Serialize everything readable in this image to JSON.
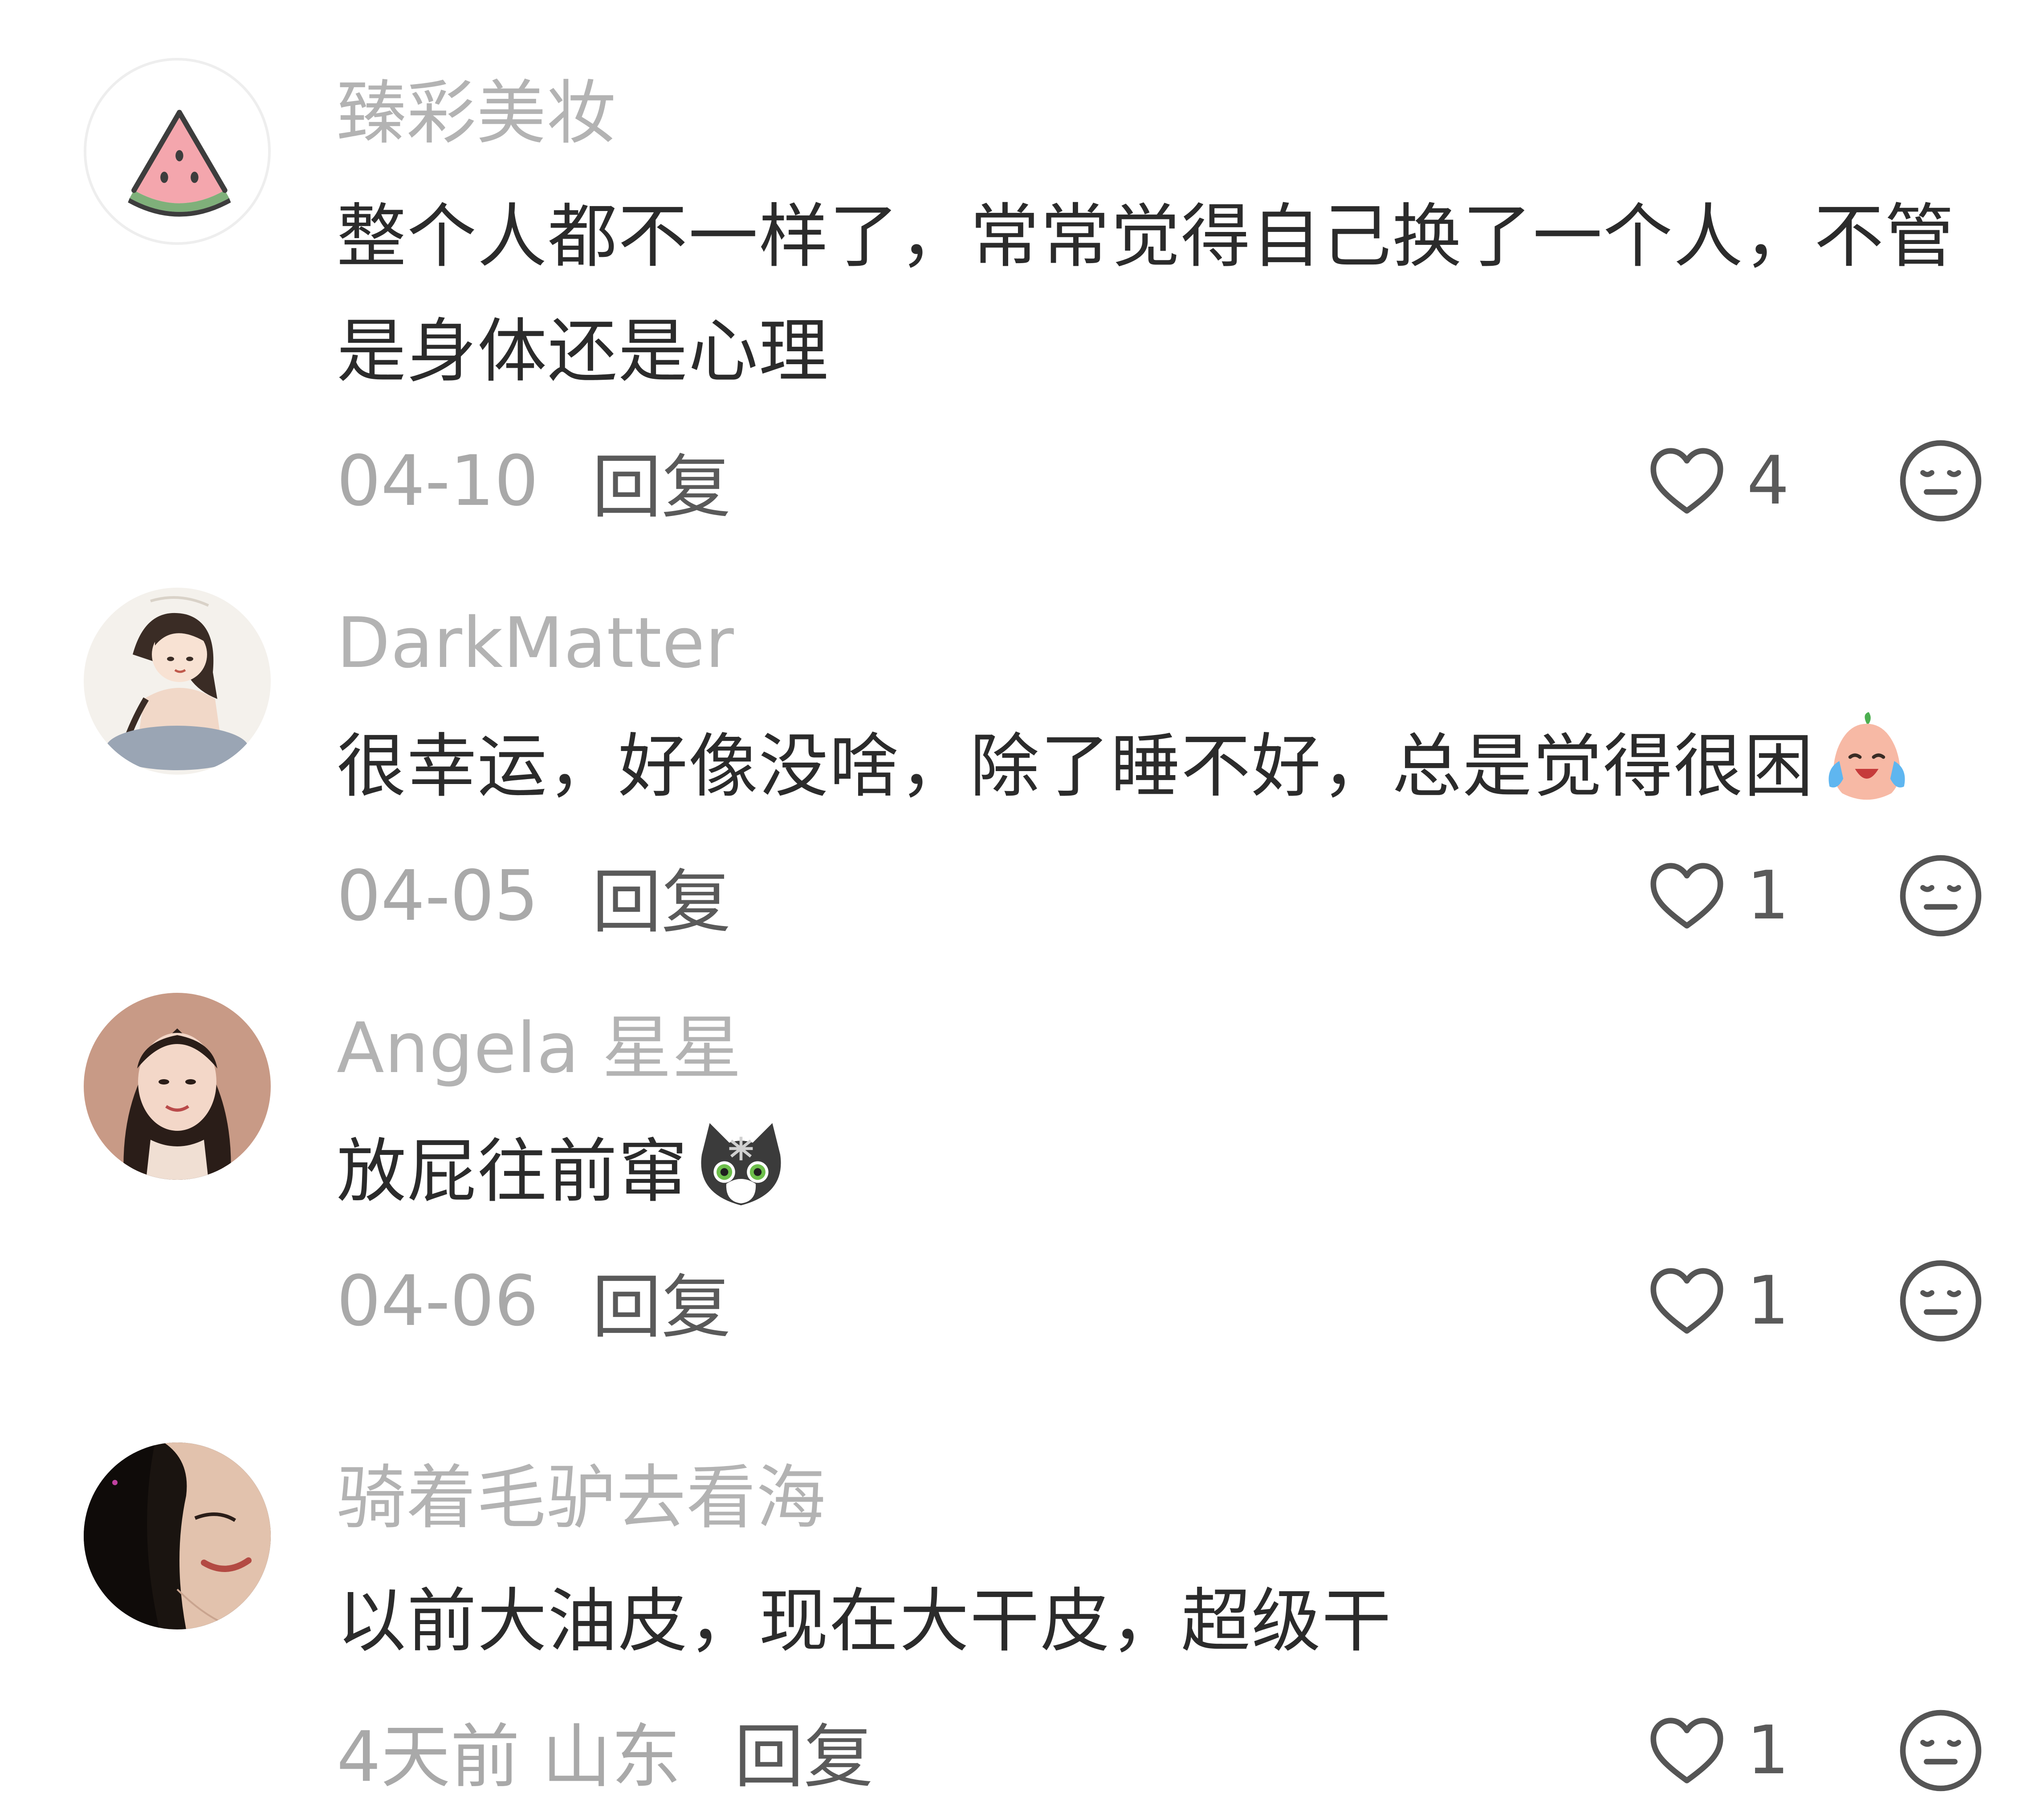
{
  "comments": [
    {
      "username": "臻彩美妆",
      "text": "整个人都不一样了，常常觉得自己换了一个人，不管是身体还是心理",
      "date": "04-10",
      "reply_label": "回复",
      "likes": "4",
      "avatar_icon": "watermelon-icon"
    },
    {
      "username": "DarkMatter",
      "text": "很幸运，好像没啥，除了睡不好，总是觉得很困",
      "trailing_emoji": "laugh-cry-emoji",
      "date": "04-05",
      "reply_label": "回复",
      "likes": "1",
      "avatar_icon": "cartoon-girl-avatar"
    },
    {
      "username": "Angela 星星",
      "text": "放屁往前窜",
      "trailing_emoji": "cat-emoji",
      "date": "04-06",
      "reply_label": "回复",
      "likes": "1",
      "avatar_icon": "woman-braids-avatar"
    },
    {
      "username": "骑着毛驴去看海",
      "text": "以前大油皮，现在大干皮，超级干",
      "date": "4天前 山东",
      "reply_label": "回复",
      "likes": "1",
      "avatar_icon": "woman-dark-photo-avatar"
    }
  ],
  "colors": {
    "username": "#b3b3b3",
    "body_text": "#2b2b2b",
    "date": "#a9a9a9",
    "action": "#5a5a5a"
  }
}
